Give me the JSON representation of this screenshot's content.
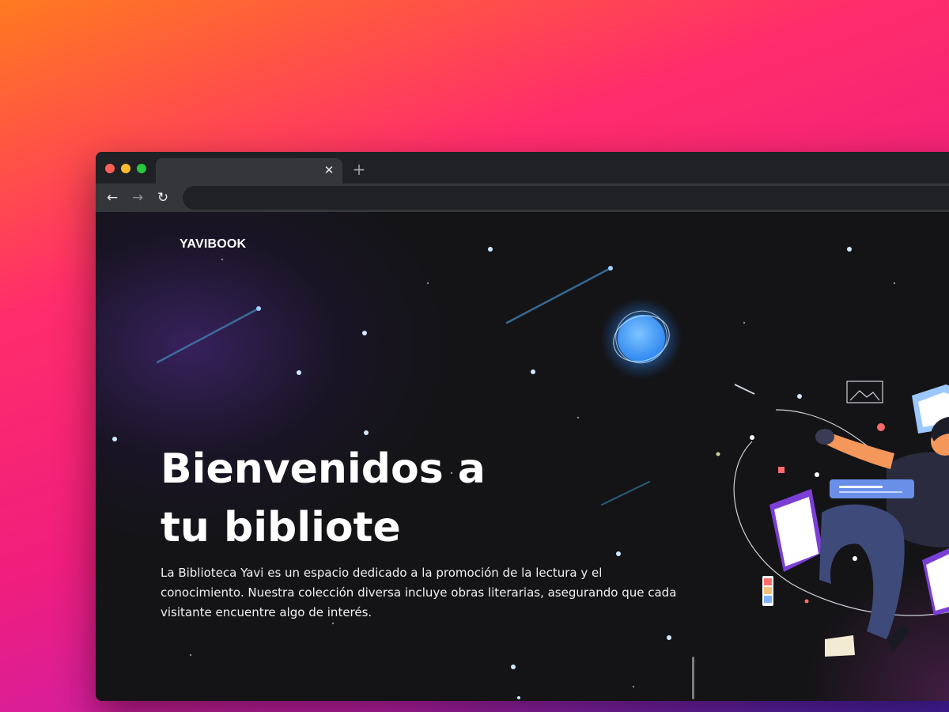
{
  "browser": {
    "tab_close_glyph": "✕",
    "new_tab_glyph": "+",
    "back_glyph": "←",
    "forward_glyph": "→",
    "reload_glyph": "↻",
    "address_value": ""
  },
  "page": {
    "logo": "YAVIBOOK",
    "hero_title_line1": "Bienvenidos a",
    "hero_title_line2": "tu bibliote",
    "hero_text": "La Biblioteca Yavi es un espacio dedicado a la promoción de la lectura y el conocimiento. Nuestra colección diversa incluye obras literarias, asegurando que cada visitante encuentre algo de interés."
  },
  "colors": {
    "accent_blue": "#4fa3ff",
    "background_dark": "#141416",
    "illustration_orange": "#f4975a",
    "illustration_purple": "#7b3fd6"
  },
  "icons": [
    "window-close-icon",
    "window-minimize-icon",
    "window-maximize-icon",
    "tab-close-icon",
    "new-tab-icon",
    "back-arrow-icon",
    "forward-arrow-icon",
    "reload-icon",
    "planet-icon",
    "reading-person-illustration"
  ]
}
